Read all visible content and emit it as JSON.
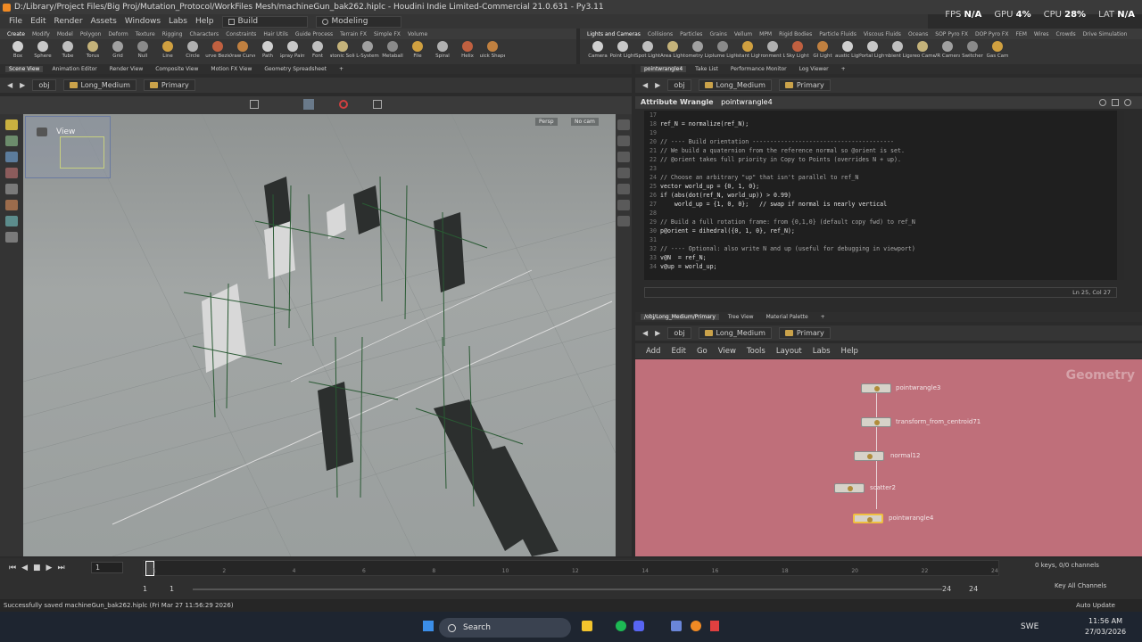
{
  "window": {
    "title": "D:/Library/Project Files/Big Proj/Mutation_Protocol/WorkFiles Mesh/machineGun_bak262.hiplc - Houdini Indie Limited-Commercial 21.0.631 - Py3.11"
  },
  "perf": {
    "fps_label": "FPS",
    "fps_value": "N/A",
    "gpu_label": "GPU",
    "gpu_value": "4%",
    "cpu_label": "CPU",
    "cpu_value": "28%",
    "lat_label": "LAT",
    "lat_value": "N/A"
  },
  "menu": {
    "items": [
      "File",
      "Edit",
      "Render",
      "Assets",
      "Windows",
      "Labs",
      "Help"
    ],
    "desk1": "Build",
    "desk2": "Modeling"
  },
  "shelf": {
    "left_tabs": [
      "Create",
      "Modify",
      "Model",
      "Polygon",
      "Deform",
      "Texture",
      "Rigging",
      "Characters",
      "Constraints",
      "Hair Utils",
      "Guide Process",
      "Terrain FX",
      "Simple FX",
      "Volume"
    ],
    "right_tabs": [
      "Lights and Cameras",
      "Collisions",
      "Particles",
      "Grains",
      "Vellum",
      "MPM",
      "Rigid Bodies",
      "Particle Fluids",
      "Viscous Fluids",
      "Oceans",
      "SOP Pyro FX",
      "DOP Pyro FX",
      "FEM",
      "Wires",
      "Crowds",
      "Drive Simulation"
    ],
    "left_tools": [
      "Box",
      "Sphere",
      "Tube",
      "Torus",
      "Grid",
      "Null",
      "Line",
      "Circle",
      "Curve Bezier",
      "Draw Curve",
      "Path",
      "Spray Paint",
      "Font",
      "Platonic Solids",
      "L-System",
      "Metaball",
      "File",
      "Spiral",
      "Helix",
      "Quick Shapes"
    ],
    "right_tools": [
      "Camera",
      "Point Light",
      "Spot Light",
      "Area Light",
      "Geometry Light",
      "Volume Light",
      "Distant Light",
      "Environment Light",
      "Sky Light",
      "GI Light",
      "Caustic Light",
      "Portal Light",
      "Ambient Light",
      "Stereo Camera",
      "VR Camera",
      "Switcher",
      "Gas Cam"
    ]
  },
  "left_pane": {
    "tabs": [
      "Scene View",
      "Animation Editor",
      "Render View",
      "Composite View",
      "Motion FX View",
      "Geometry Spreadsheet"
    ],
    "path_root": "obj",
    "path_obj": "Long_Medium",
    "path_geo": "Primary",
    "view_label": "View",
    "persp": "Persp",
    "nocam": "No cam"
  },
  "right_top": {
    "tabs": [
      "pointwrangle4",
      "Take List",
      "Performance Monitor",
      "Log Viewer"
    ],
    "path_root": "obj",
    "path_obj": "Long_Medium",
    "path_geo": "Primary",
    "node_type": "Attribute Wrangle",
    "node_name": "pointwrangle4",
    "cursor_pos": "Ln 25, Col 27",
    "code_lines": [
      {
        "n": "17",
        "t": "",
        "c": false
      },
      {
        "n": "18",
        "t": "ref_N = normalize(ref_N);",
        "c": false
      },
      {
        "n": "19",
        "t": "",
        "c": false
      },
      {
        "n": "20",
        "t": "// ---- Build orientation ----------------------------------------",
        "c": true
      },
      {
        "n": "21",
        "t": "// We build a quaternion from the reference normal so @orient is set.",
        "c": true
      },
      {
        "n": "22",
        "t": "// @orient takes full priority in Copy to Points (overrides N + up).",
        "c": true
      },
      {
        "n": "23",
        "t": "",
        "c": false
      },
      {
        "n": "24",
        "t": "// Choose an arbitrary \"up\" that isn't parallel to ref_N",
        "c": true
      },
      {
        "n": "25",
        "t": "vector world_up = {0, 1, 0};",
        "c": false
      },
      {
        "n": "26",
        "t": "if (abs(dot(ref_N, world_up)) > 0.99)",
        "c": false
      },
      {
        "n": "27",
        "t": "    world_up = {1, 0, 0};   // swap if normal is nearly vertical",
        "c": false
      },
      {
        "n": "28",
        "t": "",
        "c": false
      },
      {
        "n": "29",
        "t": "// Build a full rotation frame: from {0,1,0} (default copy fwd) to ref_N",
        "c": true
      },
      {
        "n": "30",
        "t": "p@orient = dihedral({0, 1, 0}, ref_N);",
        "c": false
      },
      {
        "n": "31",
        "t": "",
        "c": false
      },
      {
        "n": "32",
        "t": "// ---- Optional: also write N and up (useful for debugging in viewport)",
        "c": true
      },
      {
        "n": "33",
        "t": "v@N  = ref_N;",
        "c": false
      },
      {
        "n": "34",
        "t": "v@up = world_up;",
        "c": false
      }
    ]
  },
  "right_bottom": {
    "tabs": [
      "/obj/Long_Medium/Primary",
      "Tree View",
      "Material Palette"
    ],
    "path_root": "obj",
    "path_obj": "Long_Medium",
    "path_geo": "Primary",
    "menu": [
      "Add",
      "Edit",
      "Go",
      "View",
      "Tools",
      "Layout",
      "Labs",
      "Help"
    ],
    "context_label": "Geometry",
    "nodes": [
      {
        "name": "pointwrangle3"
      },
      {
        "name": "transform_from_centroid71"
      },
      {
        "name": "normal12"
      },
      {
        "name": "scatter2"
      },
      {
        "name": "pointwrangle4"
      }
    ]
  },
  "timeline": {
    "frame": "1",
    "start": "1",
    "start2": "1",
    "end": "24",
    "end2": "24",
    "ticks": [
      "1",
      "2",
      "4",
      "6",
      "8",
      "10",
      "12",
      "14",
      "16",
      "18",
      "20",
      "22",
      "24"
    ],
    "keys_info": "0 keys, 0/0 channels",
    "key_channels": "Key All Channels",
    "auto_update": "Auto Update"
  },
  "status": {
    "message": "Successfully saved machineGun_bak262.hiplc (Fri Mar 27 11:56:29 2026)"
  },
  "taskbar": {
    "search_placeholder": "Search",
    "lang": "SWE",
    "time": "11:56 AM",
    "date": "27/03/2026"
  }
}
